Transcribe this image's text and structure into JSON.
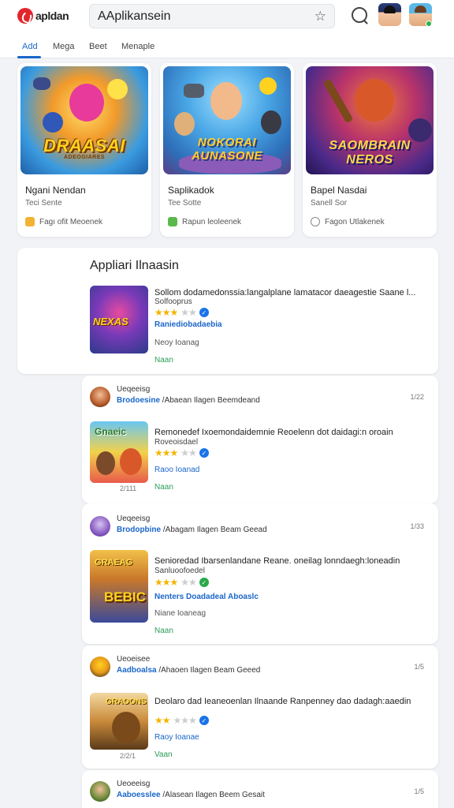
{
  "header": {
    "logo_text": "apldan",
    "search_value": "AAplikansein",
    "search_placeholder": ""
  },
  "tabs": [
    {
      "label": "Add",
      "active": true
    },
    {
      "label": "Mega",
      "active": false
    },
    {
      "label": "Beet",
      "active": false
    },
    {
      "label": "Menaple",
      "active": false
    }
  ],
  "featured": [
    {
      "art_title": "DRAASAI",
      "art_sub": "ADEOGIARES",
      "name": "Ngani Nendan",
      "sub": "Teci Sente",
      "foot": "Fagı ofit Meoenek",
      "foot_icon_color": "#f2b233"
    },
    {
      "art_title": "NOKORAI AUNASONE",
      "name": "Saplikadok",
      "sub": "Tee Sotte",
      "foot": "Rapun leoleenek",
      "foot_icon_color": "#5bb84a"
    },
    {
      "art_title": "SAOMBRAIN NEROS",
      "name": "Bapel Nasdai",
      "sub": "Sanell Sor",
      "foot": "Fagon Utlakenek",
      "foot_icon_color": "#888888"
    }
  ],
  "list": {
    "section_title": "Appliari Ilnaasin",
    "top_app": {
      "title": "Sollom dodamedonssia:langalplane lamatacor daeagestie Saane  l...",
      "subtitle": "Solfooprus",
      "rating": 3.5,
      "developer": "Raniediobadaebia",
      "meta": "Neoy Ioanag",
      "cta": "Naan"
    },
    "posts": [
      {
        "name": "Ueqeeisg",
        "developer": "Brodoesine",
        "line": "/Abaean Ilagen Beemdeand",
        "time": "1/22",
        "app_title": "Remonedef Ixoemondaidemnie Reoelenn dot daidagi:n oroain",
        "app_subtitle": "Roveoisdael",
        "rating": 3.0,
        "app_meta": "Raoo Ioanad",
        "cta": "Naan",
        "thumb_caption": "2/111"
      },
      {
        "name": "Ueqeeisg",
        "developer": "Brodopbine",
        "line": "/Abagam Ilagen Beam Geead",
        "time": "1/33",
        "app_title": "Senioredad Ibarsenlandane Reane. oneilag lonndaegh:loneadin",
        "app_subtitle": "Sanluoofoedel",
        "rating": 3.5,
        "app_developer": "Nenters Doadadeal Aboaslc",
        "app_meta": "Niane Ioaneag",
        "cta": "Naan"
      },
      {
        "name": "Ueoeisee",
        "developer": "Aadboalsa",
        "line": "/Ahaoen Ilagen Beam Geeed",
        "time": "1/5",
        "app_title": "Deolaro dad Ieaneoenlan Ilnaande Ranpenney dao dadagh:aaedin",
        "rating": 2.5,
        "app_meta": "Raoy Ioanae",
        "cta": "Vaan",
        "thumb_caption": "2/2/1"
      },
      {
        "name": "Ueoeeisg",
        "developer": "Aaboesslee",
        "line": "/Alasean Ilagen Beem Gesait",
        "time": "1/5"
      }
    ]
  },
  "colors": {
    "accent": "#1a66c9",
    "star": "#f4b400",
    "cta_green": "#2a9d5a",
    "brand_red": "#e3262e"
  }
}
